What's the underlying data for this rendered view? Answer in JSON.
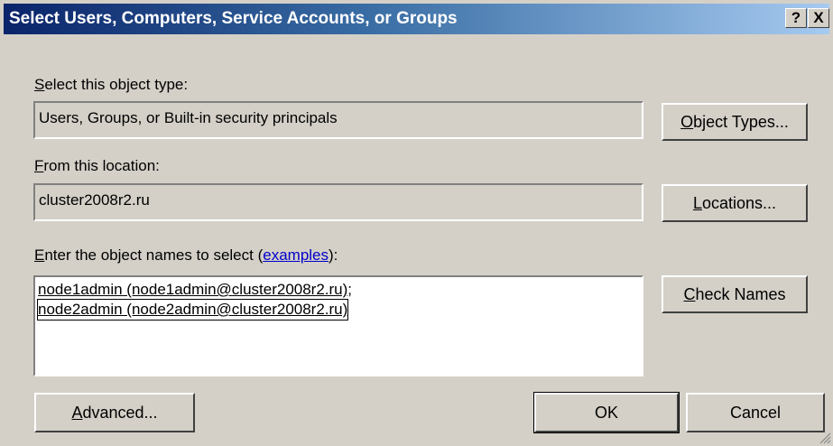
{
  "window": {
    "title": "Select Users, Computers, Service Accounts, or Groups",
    "help_glyph": "?",
    "close_glyph": "X"
  },
  "object_type": {
    "label_accel": "S",
    "label_rest": "elect this object type:",
    "value": "Users, Groups, or Built-in security principals",
    "button_accel": "O",
    "button_rest": "bject Types..."
  },
  "location": {
    "label_accel": "F",
    "label_rest": "rom this location:",
    "value": "cluster2008r2.ru",
    "button_accel": "L",
    "button_rest": "ocations..."
  },
  "names": {
    "label_accel": "E",
    "label_rest": "nter the object names to select (",
    "link_text": "examples",
    "label_end": "):",
    "entries": [
      "node1admin (node1admin@cluster2008r2.ru)",
      "node2admin (node2admin@cluster2008r2.ru)"
    ],
    "separator": ";",
    "button_accel": "C",
    "button_rest": "heck Names"
  },
  "footer": {
    "advanced_accel": "A",
    "advanced_rest": "dvanced...",
    "ok_label": "OK",
    "cancel_label": "Cancel"
  }
}
